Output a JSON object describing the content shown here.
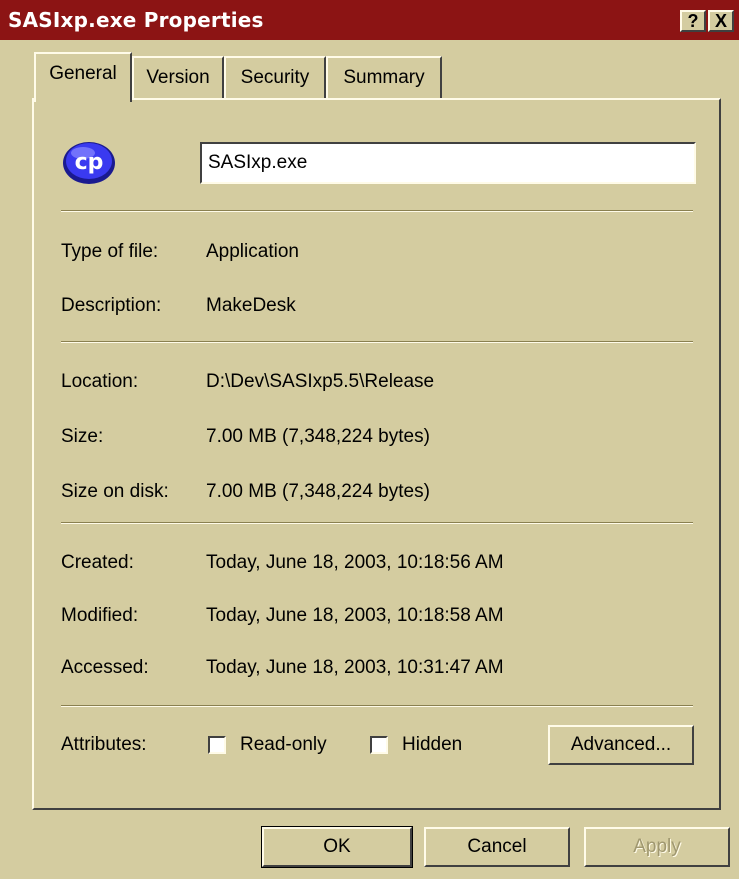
{
  "window": {
    "title": "SASIxp.exe Properties",
    "help_label": "?",
    "close_label": "X"
  },
  "tabs": [
    {
      "label": "General",
      "active": true
    },
    {
      "label": "Version",
      "active": false
    },
    {
      "label": "Security",
      "active": false
    },
    {
      "label": "Summary",
      "active": false
    }
  ],
  "icon": {
    "name": "application-icon",
    "text": "cp"
  },
  "file_name": "SASIxp.exe",
  "fields": {
    "type": {
      "label": "Type of file:",
      "value": "Application"
    },
    "description": {
      "label": "Description:",
      "value": "MakeDesk"
    },
    "location": {
      "label": "Location:",
      "value": "D:\\Dev\\SASIxp5.5\\Release"
    },
    "size": {
      "label": "Size:",
      "value": "7.00 MB (7,348,224 bytes)"
    },
    "size_on_disk": {
      "label": "Size on disk:",
      "value": "7.00 MB (7,348,224 bytes)"
    },
    "created": {
      "label": "Created:",
      "value": "Today, June 18, 2003, 10:18:56 AM"
    },
    "modified": {
      "label": "Modified:",
      "value": "Today, June 18, 2003, 10:18:58 AM"
    },
    "accessed": {
      "label": "Accessed:",
      "value": "Today, June 18, 2003, 10:31:47 AM"
    }
  },
  "attributes": {
    "label": "Attributes:",
    "readonly": {
      "label": "Read-only",
      "checked": false
    },
    "hidden": {
      "label": "Hidden",
      "checked": false
    },
    "advanced_label": "Advanced..."
  },
  "buttons": {
    "ok": "OK",
    "cancel": "Cancel",
    "apply": "Apply"
  },
  "colors": {
    "titlebar": "#8c1414",
    "face": "#d4cca0",
    "icon_blue": "#2020d0"
  }
}
